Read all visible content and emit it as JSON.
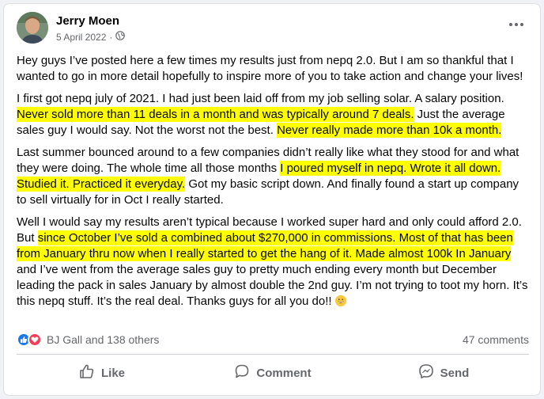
{
  "post": {
    "author": "Jerry Moen",
    "date": "5 April 2022",
    "separator": "·",
    "privacy_icon": "globe-icon",
    "more_icon": "more-options-icon",
    "paragraphs": [
      [
        {
          "text": "Hey guys I’ve posted here a few times my results just from nepq 2.0. But I am so thankful that I wanted to go in more detail hopefully to inspire more of you to take action and change your lives!",
          "hl": false
        }
      ],
      [
        {
          "text": "I first got nepq july of 2021. I had just been laid off from my job selling solar. A salary position. ",
          "hl": false
        },
        {
          "text": "Never sold more than 11 deals in a month and was typically around 7 deals.",
          "hl": true
        },
        {
          "text": " Just the average sales guy I would say. Not the worst not the best. ",
          "hl": false
        },
        {
          "text": "Never really made more than 10k a month.",
          "hl": true
        }
      ],
      [
        {
          "text": "Last summer bounced around to a few companies didn’t really like what they stood for and what they were doing. The whole time all those months ",
          "hl": false
        },
        {
          "text": "I poured myself in nepq. Wrote it all down. Studied it. Practiced it everyday.",
          "hl": true
        },
        {
          "text": " Got my basic script down. And finally found a start up company to sell virtually for in Oct I really started.",
          "hl": false
        }
      ],
      [
        {
          "text": "Well I would say my results aren’t typical because I worked super hard and only could afford 2.0. But ",
          "hl": false
        },
        {
          "text": "since October I’ve sold a combined about $270,000 in commissions. Most of that has been from January thru now when I really started to get the hang of it. Made almost 100k In January",
          "hl": true
        },
        {
          "text": " and I’ve went from the average sales guy to pretty much ending every month but December leading the pack in sales January by almost double the 2nd guy. I’m not trying to toot my horn. It’s this nepq stuff. It’s the real deal. Thanks guys for all you do!! ",
          "hl": false
        }
      ]
    ],
    "reactions": {
      "icons": [
        "like-reaction-icon",
        "love-reaction-icon"
      ],
      "summary": "BJ Gall and 138 others"
    },
    "comments_count": "47 comments",
    "actions": {
      "like": "Like",
      "comment": "Comment",
      "send": "Send"
    },
    "colors": {
      "highlight": "#ffff00",
      "like_blue": "#1877f2",
      "love_red": "#f33e58",
      "secondary_text": "#65676b"
    }
  }
}
